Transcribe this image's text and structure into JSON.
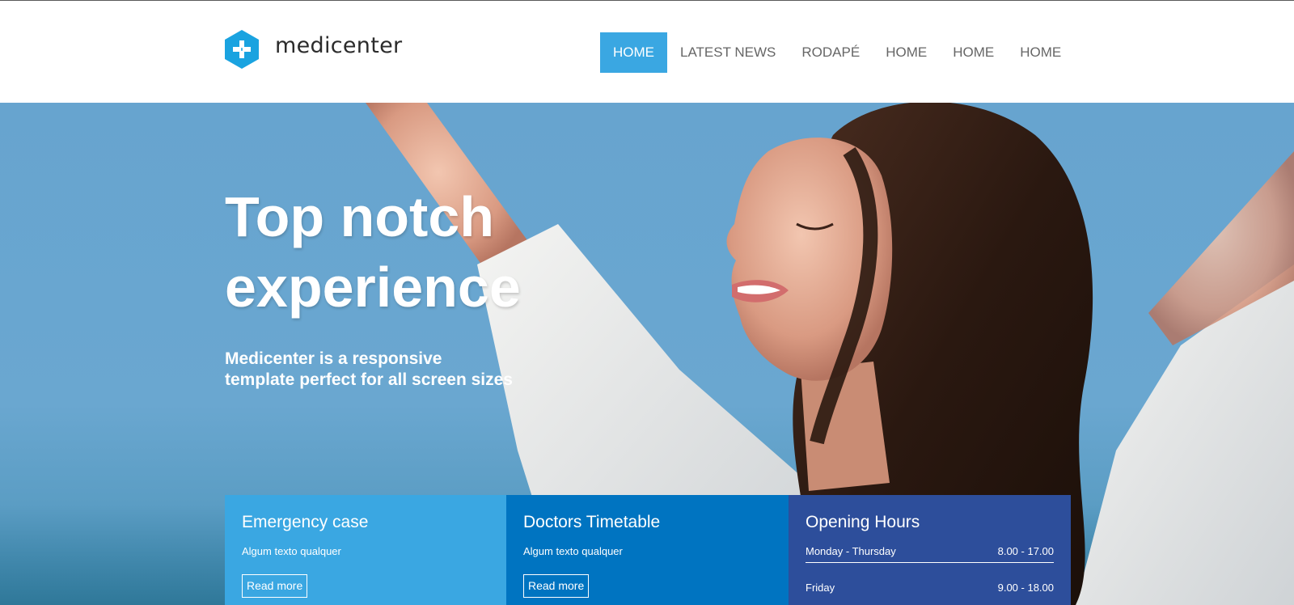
{
  "brand": {
    "name": "medicenter",
    "accent": "#3aa7e2"
  },
  "nav": {
    "items": [
      {
        "label": "HOME",
        "active": true
      },
      {
        "label": "LATEST NEWS",
        "active": false
      },
      {
        "label": "RODAPÉ",
        "active": false
      },
      {
        "label": "HOME",
        "active": false
      },
      {
        "label": "HOME",
        "active": false
      },
      {
        "label": "HOME",
        "active": false
      }
    ]
  },
  "hero": {
    "title_line1": "Top notch",
    "title_line2": "experience",
    "subtitle": "Medicenter is a responsive template perfect for all screen sizes"
  },
  "boxes": [
    {
      "title": "Emergency case",
      "text": "Algum texto qualquer",
      "button": "Read more",
      "color": "#3aa7e2"
    },
    {
      "title": "Doctors Timetable",
      "text": "Algum texto qualquer",
      "button": "Read more",
      "color": "#0074c1"
    },
    {
      "title": "Opening Hours",
      "color": "#2d4e9b",
      "hours": [
        {
          "days": "Monday - Thursday",
          "time": "8.00 - 17.00"
        },
        {
          "days": "Friday",
          "time": "9.00 - 18.00"
        }
      ]
    }
  ]
}
